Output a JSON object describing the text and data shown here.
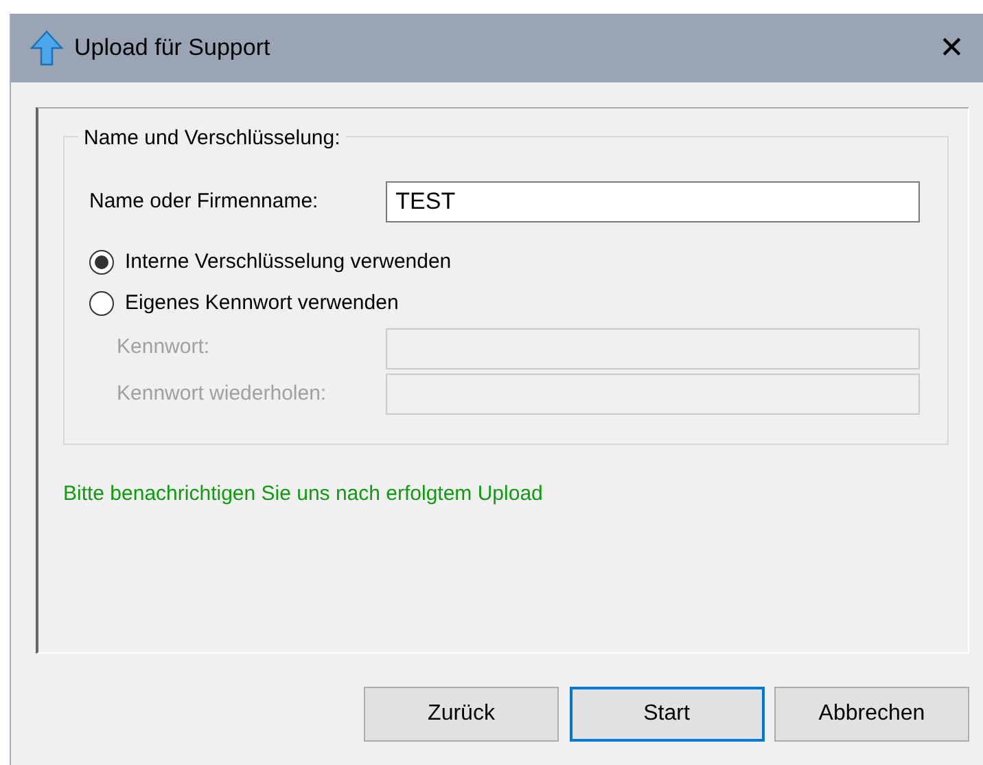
{
  "window": {
    "title": "Upload für Support",
    "close": "✕"
  },
  "group": {
    "title": "Name und Verschlüsselung:",
    "name_field": {
      "label": "Name oder Firmenname:",
      "value": "TEST"
    },
    "options": [
      {
        "label": "Interne Verschlüsselung verwenden",
        "selected": true
      },
      {
        "label": "Eigenes Kennwort verwenden",
        "selected": false
      }
    ],
    "password_fields": [
      {
        "label": "Kennwort:",
        "disabled": true
      },
      {
        "label": "Kennwort wiederholen:",
        "disabled": true
      }
    ]
  },
  "notice": "Bitte benachrichtigen Sie uns nach erfolgtem Upload",
  "buttons": [
    {
      "label": "Zurück",
      "focused": false
    },
    {
      "label": "Start",
      "focused": true
    },
    {
      "label": "Abbrechen",
      "focused": false
    }
  ]
}
